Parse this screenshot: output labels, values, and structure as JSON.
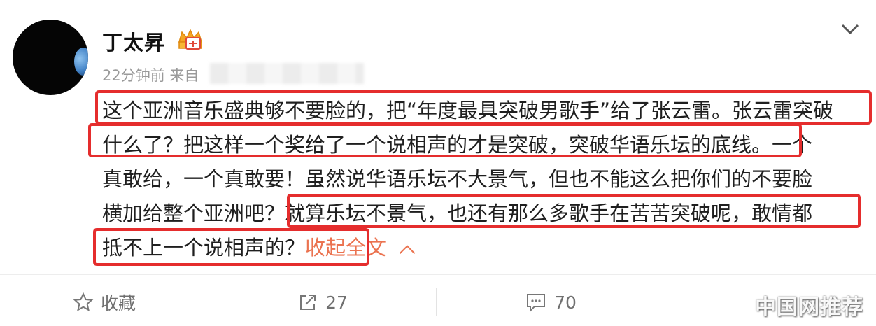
{
  "post": {
    "author": "丁太昇",
    "time_source": "22分钟前 来自",
    "lines": [
      "这个亚洲音乐盛典够不要脸的，把“年度最具突破男歌手”给了张云雷。张云雷突破",
      "什么了？把这样一个奖给了一个说相声的才是突破，突破华语乐坛的底线。一个",
      "真敢给，一个真敢要！虽然说华语乐坛不大景气，但也不能这么把你们的不要脸",
      "横加给整个亚洲吧？就算乐坛不景气，也还有那么多歌手在苦苦突破呢，敢情都",
      "抵不上一个说相声的？"
    ],
    "collapse_label": "收起全文"
  },
  "actions": {
    "favorite_label": "收藏",
    "share_count": "27",
    "comment_count": "70"
  },
  "watermark": "中国网推荐",
  "colors": {
    "highlight": "#e52d2d",
    "link": "#eb7350"
  },
  "icons": [
    "chevron-down-icon",
    "crown-badge-icon",
    "star-icon",
    "share-icon",
    "comment-icon"
  ]
}
